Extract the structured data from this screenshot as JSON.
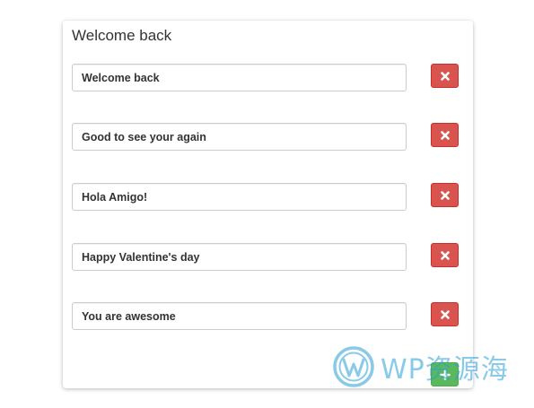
{
  "card": {
    "title": "Welcome back"
  },
  "messages": [
    {
      "value": "Welcome back"
    },
    {
      "value": "Good to see your again"
    },
    {
      "value": "Hola Amigo!"
    },
    {
      "value": "Happy Valentine's day"
    },
    {
      "value": "You are awesome"
    }
  ],
  "icons": {
    "remove": "times-icon",
    "add": "plus-icon"
  },
  "watermark": {
    "text": "WP资源海"
  },
  "colors": {
    "danger": "#d9534f",
    "success": "#5cb85c",
    "watermark": "#2a9fd6"
  }
}
